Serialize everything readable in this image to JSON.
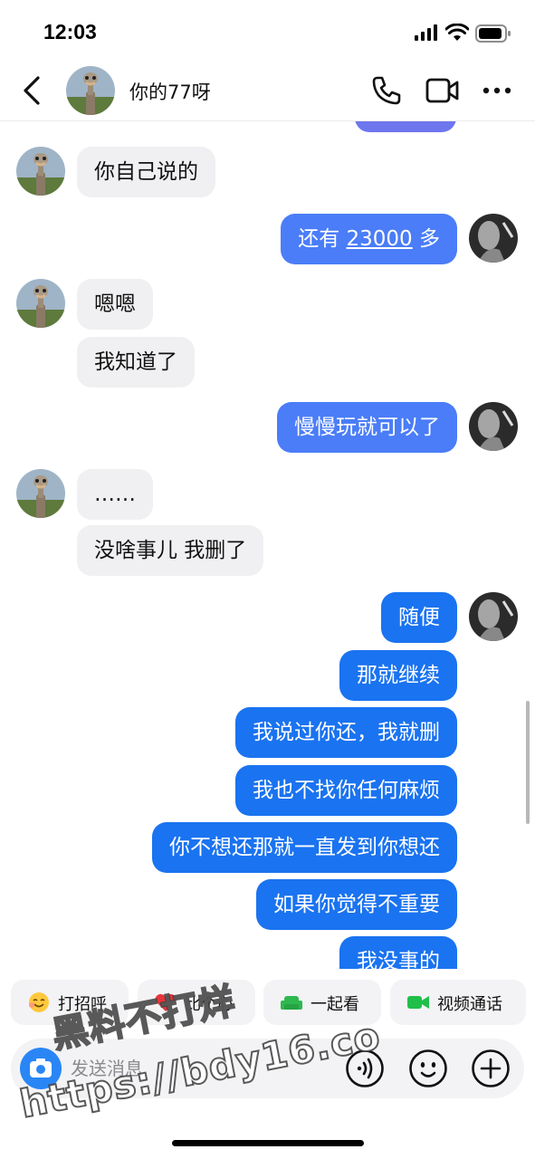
{
  "status_bar": {
    "time": "12:03"
  },
  "header": {
    "title": "你的77呀"
  },
  "messages": [
    {
      "side": "in",
      "text": "你自己说的"
    },
    {
      "side": "out",
      "text_before": "还有 ",
      "link": "23000",
      "text_after": " 多"
    },
    {
      "side": "in",
      "text": "嗯嗯"
    },
    {
      "side": "in",
      "text": "我知道了"
    },
    {
      "side": "out",
      "text": "慢慢玩就可以了"
    },
    {
      "side": "in",
      "text": "……"
    },
    {
      "side": "in",
      "text": "没啥事儿 我删了"
    },
    {
      "side": "out",
      "text": "随便"
    },
    {
      "side": "out",
      "text": "那就继续"
    },
    {
      "side": "out",
      "text": "我说过你还，我就删"
    },
    {
      "side": "out",
      "text": "我也不找你任何麻烦"
    },
    {
      "side": "out",
      "text": "你不想还那就一直发到你想还"
    },
    {
      "side": "out",
      "text": "如果你觉得不重要"
    },
    {
      "side": "out",
      "text": "我没事的"
    }
  ],
  "quick_actions": [
    {
      "label": "打招呼",
      "icon": "wave-emoji-icon"
    },
    {
      "label": "比个心",
      "icon": "heart-icon"
    },
    {
      "label": "一起看",
      "icon": "sofa-icon"
    },
    {
      "label": "视频通话",
      "icon": "video-camera-icon"
    }
  ],
  "composer": {
    "placeholder": "发送消息"
  },
  "watermark": {
    "line1": "黑料不打烊",
    "line2": "https://bdy16.co"
  },
  "colors": {
    "outgoing_light": "#4a7df7",
    "outgoing_dark": "#1a73f0",
    "incoming": "#f0f0f2",
    "accent": "#2a86f5"
  }
}
